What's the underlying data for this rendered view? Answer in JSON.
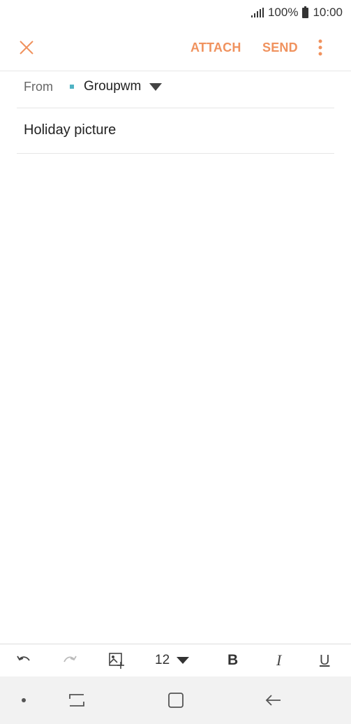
{
  "status_bar": {
    "battery_text": "100%",
    "time": "10:00"
  },
  "toolbar": {
    "close_icon": "close-icon",
    "attach_label": "ATTACH",
    "send_label": "SEND",
    "more_icon": "more-vert-icon",
    "accent_color": "#f0925e"
  },
  "compose": {
    "from_label": "From",
    "from_account": "Groupwm",
    "account_color": "#4fb3c4",
    "subject": "Holiday picture"
  },
  "format_bar": {
    "font_size": "12",
    "bold_label": "B",
    "italic_label": "I",
    "underline_label": "U"
  }
}
